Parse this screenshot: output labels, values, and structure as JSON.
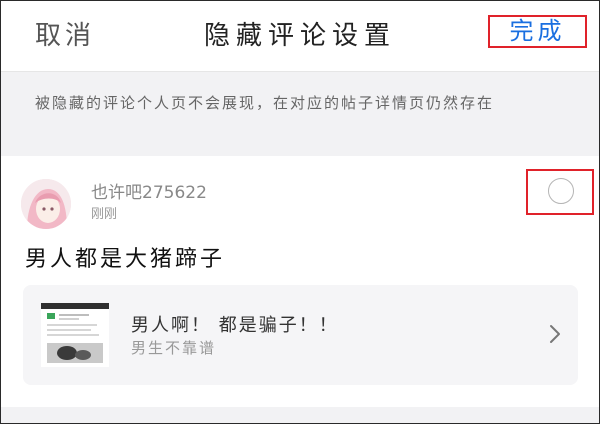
{
  "header": {
    "cancel_label": "取消",
    "title": "隐藏评论设置",
    "done_label": "完成"
  },
  "notice": {
    "text": "被隐藏的评论个人页不会展现，在对应的帖子详情页仍然存在"
  },
  "comment": {
    "avatar_icon": "user-avatar-icon",
    "username": "也许吧275622",
    "time": "刚刚",
    "text": "男人都是大猪蹄子",
    "select_icon": "radio-unselected-icon"
  },
  "post": {
    "title": "男人啊！  都是骗子！！",
    "subtitle": "男生不靠谱",
    "chevron_icon": "chevron-right-icon"
  },
  "colors": {
    "accent": "#1a6fe0",
    "highlight_box": "#e0222a",
    "notice_bg": "#f2f2f4",
    "card_bg": "#f5f5f7"
  }
}
